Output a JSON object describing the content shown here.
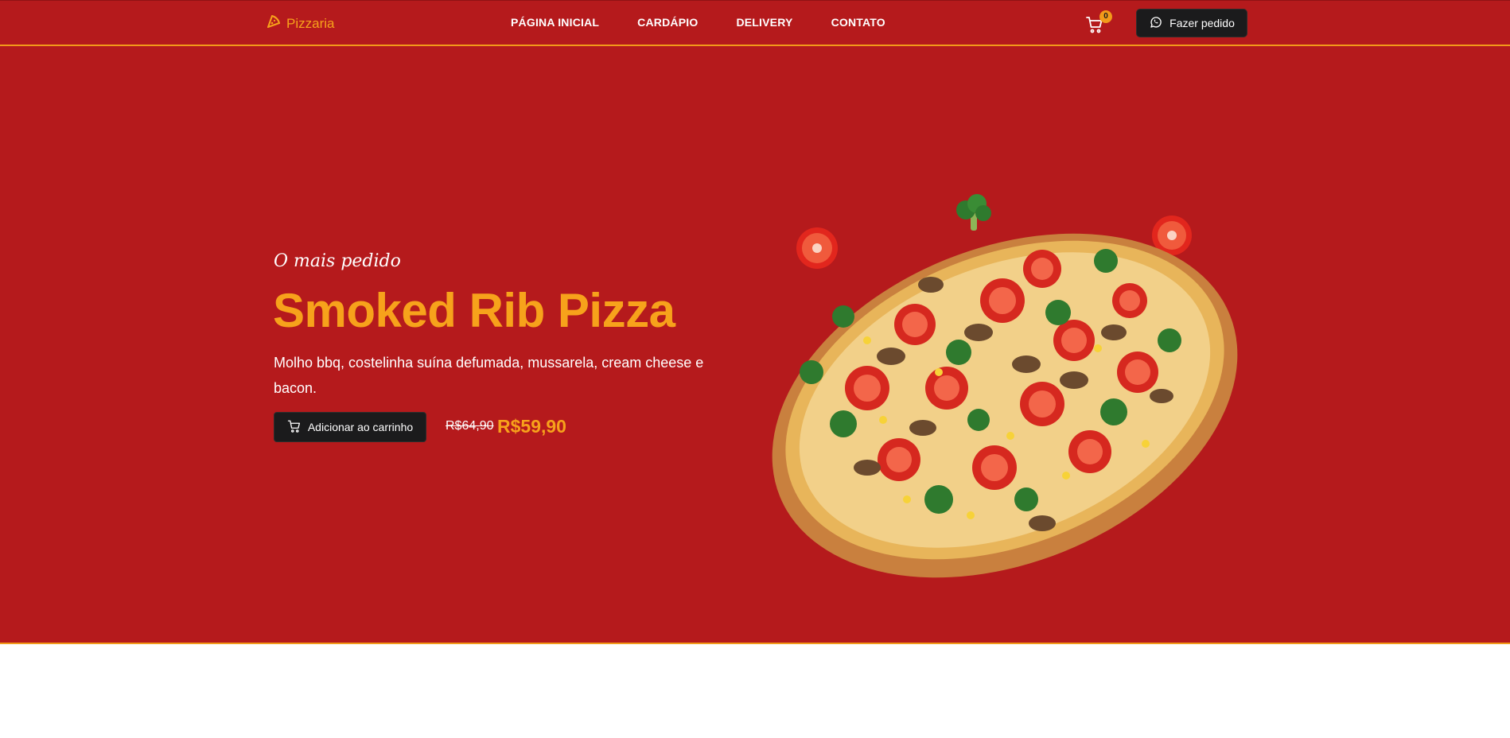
{
  "header": {
    "logo_text": "Pizzaria",
    "nav": [
      {
        "label": "PÁGINA INICIAL"
      },
      {
        "label": "CARDÁPIO"
      },
      {
        "label": "DELIVERY"
      },
      {
        "label": "CONTATO"
      }
    ],
    "cart_count": "0",
    "order_button_label": "Fazer pedido"
  },
  "hero": {
    "eyebrow": "O mais pedido",
    "title": "Smoked Rib Pizza",
    "description": "Molho bbq, costelinha suína defumada, mussarela, cream cheese e bacon.",
    "add_to_cart_label": "Adicionar ao carrinho",
    "old_price": "R$64,90",
    "new_price": "R$59,90"
  },
  "icons": {
    "logo": "pizza-slice-icon",
    "cart": "cart-icon",
    "order": "whatsapp-icon",
    "add_to_cart": "cart-icon"
  },
  "colors": {
    "brand_red": "#b51a1c",
    "accent_orange": "#f7a21b",
    "button_dark": "#1b1b1c"
  }
}
